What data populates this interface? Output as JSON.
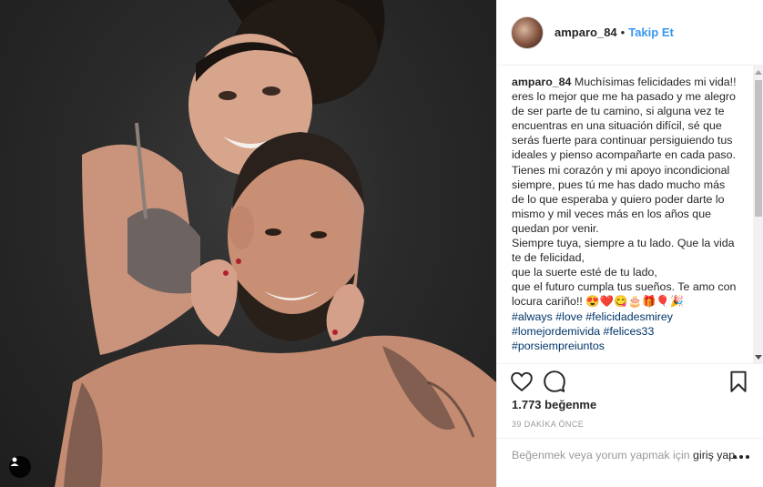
{
  "post": {
    "username": "amparo_84",
    "separator": "•",
    "follow_label": "Takip Et",
    "caption_lines": [
      "Muchísimas felicidades mi vida!! eres lo mejor que me ha pasado y me alegro de ser parte de tu camino, si alguna vez te encuentras en una situación difícil, sé que serás fuerte para continuar persiguiendo tus ideales y pienso acompañarte en cada paso.",
      "Tienes mi corazón y mi apoyo incondicional siempre, pues tú me has dado mucho más de lo que esperaba y quiero poder darte lo mismo y mil veces más en los años que quedan por venir.",
      "Siempre tuya, siempre a tu lado. Que la vida te de felicidad,",
      "que la suerte esté de tu lado,",
      "que el futuro cumpla tus sueños. Te amo con locura cariño!! 😍❤️😋🎂🎁🎈🎉"
    ],
    "hashtags": [
      "#always #love #felicidadesmirey",
      "#lomejordemivida #felices33",
      "#porsiempreiuntos"
    ],
    "likes_text": "1.773 beğenme",
    "time_ago": "39 DAKİKA ÖNCE",
    "login_prompt": "Beğenmek veya yorum yapmak için",
    "login_link": "giriş yap."
  },
  "icons": {
    "like": "heart-icon",
    "comment": "comment-icon",
    "save": "bookmark-icon",
    "user_tag": "person-icon",
    "more": "ellipsis-icon"
  },
  "colors": {
    "link": "#3897f0",
    "hashtag": "#003569",
    "muted": "#999999"
  }
}
